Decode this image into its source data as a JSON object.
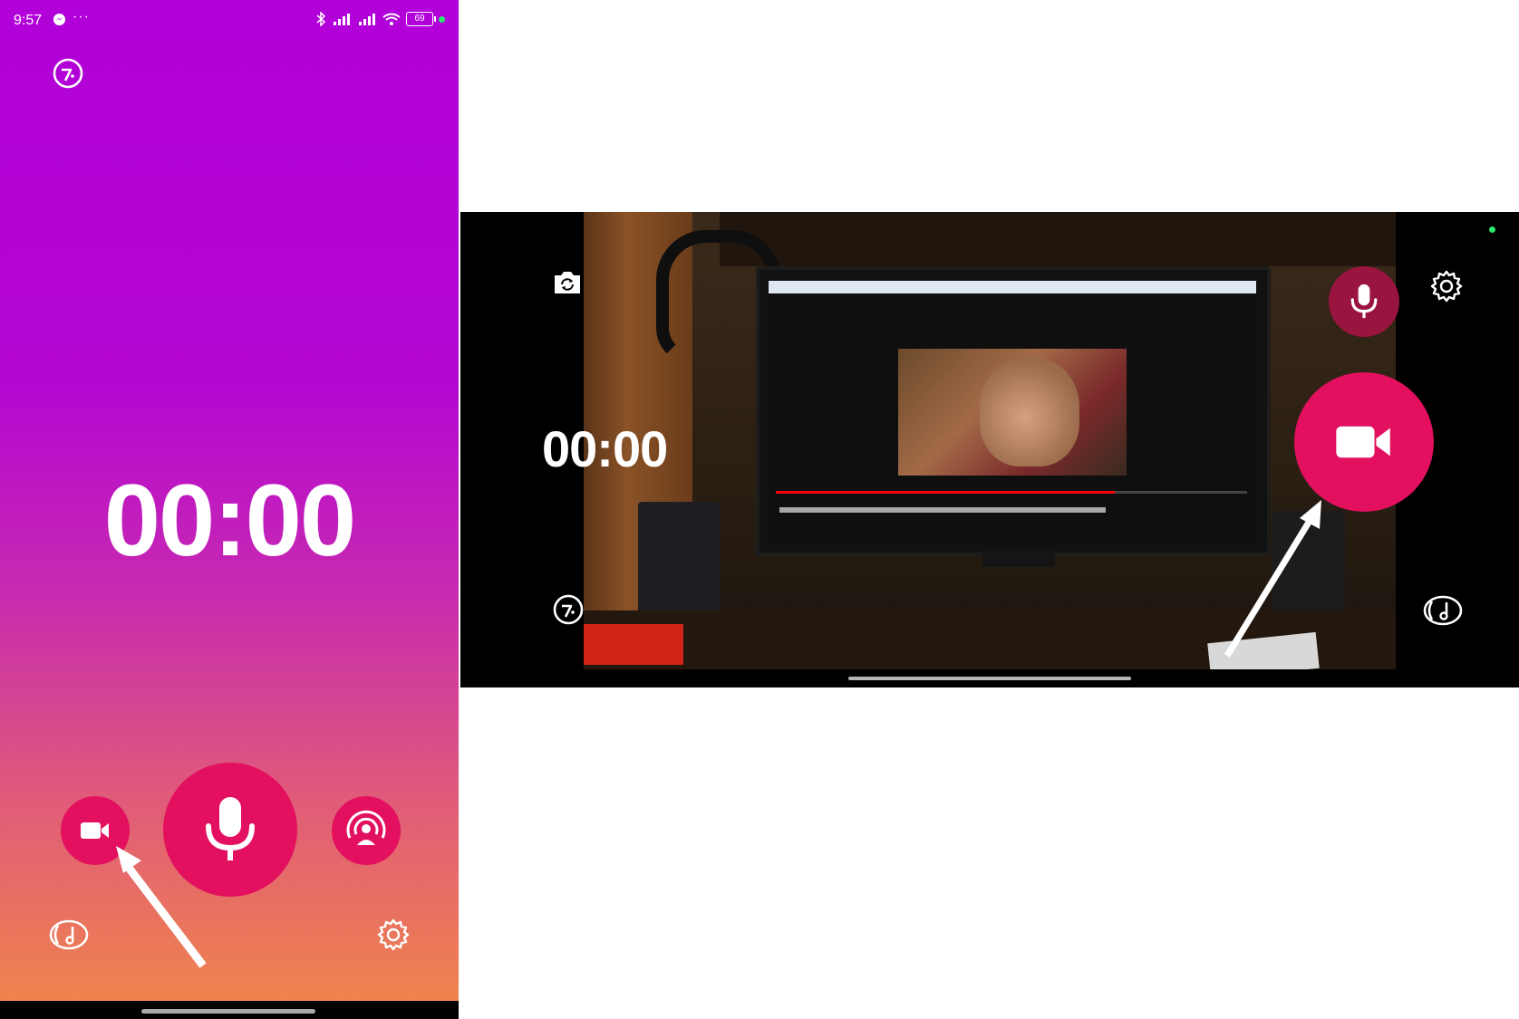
{
  "portrait": {
    "status_bar": {
      "time": "9:57",
      "dots": "···",
      "battery": "69"
    },
    "timer": "00:00",
    "icons": {
      "top_left": "tuner-icon",
      "video": "video-camera-icon",
      "record": "microphone-icon",
      "stream": "live-broadcast-icon",
      "music": "music-note-icon",
      "settings": "gear-icon"
    }
  },
  "landscape": {
    "timer": "00:00",
    "icons": {
      "switch_camera": "switch-camera-icon",
      "mic": "microphone-icon",
      "settings": "gear-icon",
      "record": "video-camera-icon",
      "tuner": "tuner-icon",
      "music": "music-note-icon"
    }
  },
  "colors": {
    "record_button": "#e3105f",
    "mic_button_landscape": "#9a1440",
    "gradient_top": "#b100d8",
    "gradient_bottom": "#f0874a",
    "recording_indicator": "#2ee86a"
  }
}
